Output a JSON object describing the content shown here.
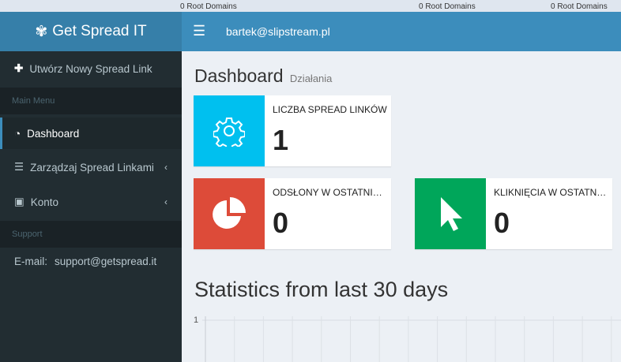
{
  "background_window": {
    "cells": [
      "0 Root Domains",
      "0 Root Domains",
      "0 Root Domains"
    ]
  },
  "app": {
    "title": "Get Spread IT",
    "user_email": "bartek@slipstream.pl"
  },
  "sidebar": {
    "create_link": "Utwórz Nowy Spread Link",
    "main_menu": "Main Menu",
    "items": [
      {
        "label": "Dashboard",
        "icon": "dashboard-icon"
      },
      {
        "label": "Zarządzaj Spread Linkami",
        "icon": "list-icon"
      },
      {
        "label": "Konto",
        "icon": "briefcase-icon"
      }
    ],
    "support": "Support",
    "email_label": "E-mail:",
    "email_value": "support@getspread.it"
  },
  "page": {
    "title": "Dashboard",
    "subtitle": "Działania"
  },
  "boxes": [
    {
      "label": "LICZBA SPREAD LINKÓW",
      "value": "1",
      "color": "#00c0ef",
      "icon": "gear-icon"
    },
    {
      "label": "ODSŁONY W OSTATNIM MIESIĄCU",
      "value": "0",
      "color": "#dd4b39",
      "icon": "pie-chart-icon"
    },
    {
      "label": "KLIKNIĘCIA W OSTATNIM MIESIĄCU",
      "value": "0",
      "color": "#00a65a",
      "icon": "cursor-icon"
    }
  ],
  "stats_title": "Statistics from last 30 days",
  "chart_data": {
    "type": "line",
    "title": "Statistics from last 30 days",
    "yticks": [
      "1"
    ],
    "ylim": [
      0,
      1
    ],
    "series": [],
    "grid": true
  }
}
